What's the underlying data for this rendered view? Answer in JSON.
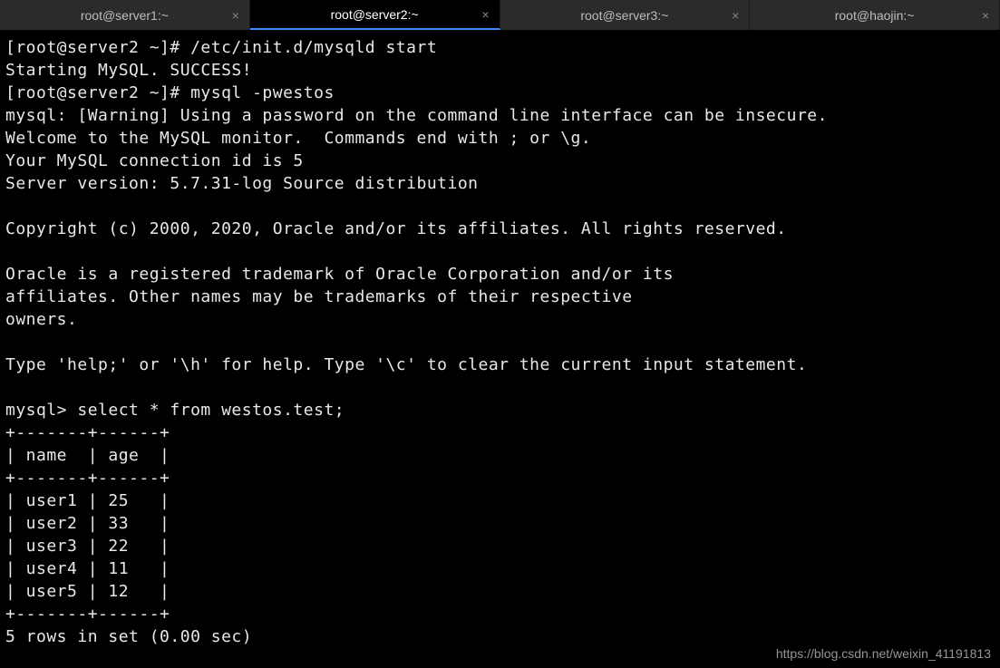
{
  "tabs": [
    {
      "label": "root@server1:~",
      "active": false
    },
    {
      "label": "root@server2:~",
      "active": true
    },
    {
      "label": "root@server3:~",
      "active": false
    },
    {
      "label": "root@haojin:~",
      "active": false
    }
  ],
  "terminal_lines": [
    "[root@server2 ~]# /etc/init.d/mysqld start",
    "Starting MySQL. SUCCESS! ",
    "[root@server2 ~]# mysql -pwestos",
    "mysql: [Warning] Using a password on the command line interface can be insecure.",
    "Welcome to the MySQL monitor.  Commands end with ; or \\g.",
    "Your MySQL connection id is 5",
    "Server version: 5.7.31-log Source distribution",
    "",
    "Copyright (c) 2000, 2020, Oracle and/or its affiliates. All rights reserved.",
    "",
    "Oracle is a registered trademark of Oracle Corporation and/or its",
    "affiliates. Other names may be trademarks of their respective",
    "owners.",
    "",
    "Type 'help;' or '\\h' for help. Type '\\c' to clear the current input statement.",
    "",
    "mysql> select * from westos.test;",
    "+-------+------+",
    "| name  | age  |",
    "+-------+------+",
    "| user1 | 25   |",
    "| user2 | 33   |",
    "| user3 | 22   |",
    "| user4 | 11   |",
    "| user5 | 12   |",
    "+-------+------+",
    "5 rows in set (0.00 sec)"
  ],
  "watermark": "https://blog.csdn.net/weixin_41191813",
  "close_glyph": "×"
}
